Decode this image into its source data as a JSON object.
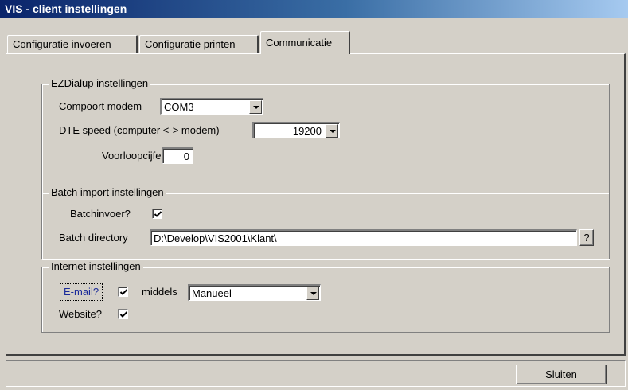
{
  "window": {
    "title": "VIS - client instellingen"
  },
  "tabs": [
    {
      "label": "Configuratie invoeren"
    },
    {
      "label": "Configuratie printen"
    },
    {
      "label": "Communicatie"
    }
  ],
  "ezdialup": {
    "legend": "EZDialup instellingen",
    "compoort_label": "Compoort modem",
    "compoort_value": "COM3",
    "dte_label": "DTE speed (computer <-> modem)",
    "dte_value": "19200",
    "voorloop_label": "Voorloopcijfer?",
    "voorloop_value": "0"
  },
  "batch": {
    "legend": "Batch import instellingen",
    "batchinvoer_label": "Batchinvoer?",
    "batchinvoer_checked": true,
    "directory_label": "Batch directory",
    "directory_value": "D:\\Develop\\VIS2001\\Klant\\",
    "browse_label": "?"
  },
  "internet": {
    "legend": "Internet instellingen",
    "email_label": "E-mail?",
    "email_checked": true,
    "middels_label": "middels",
    "middels_value": "Manueel",
    "website_label": "Website?",
    "website_checked": true
  },
  "footer": {
    "close_label": "Sluiten"
  },
  "colors": {
    "title_start": "#0a246a",
    "title_end": "#a6caf0",
    "face": "#d4d0c8"
  }
}
